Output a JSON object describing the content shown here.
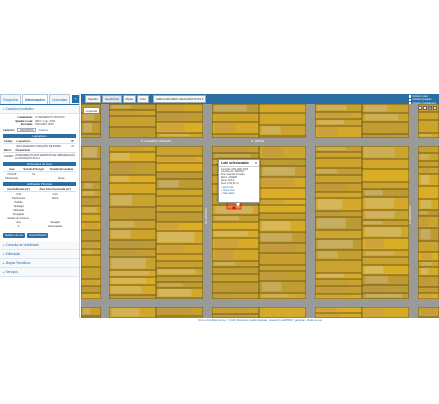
{
  "left_panel": {
    "tabs": [
      {
        "label": "Geoportal"
      },
      {
        "label": "Informações"
      },
      {
        "label": "Consultas"
      }
    ],
    "sections": {
      "cadastro_header": "Cadastro Imobiliário",
      "consulta_header": "Consulta de Viabilidade",
      "edificacao_header": "Edificação",
      "mapas_header": "Mapas Temáticos",
      "servicos_header": "Serviços"
    },
    "cadastro": {
      "loteamento_label": "Loteamento:",
      "loteamento_value": "LOTEAMENTO CENTRO",
      "quadra_label": "Quadra / Lote:",
      "quadra_value": "0827 / Lote: 0033",
      "inscricao_label": "Inscrição:",
      "inscricao_value": "0001.0827.0033",
      "cadastro_label": "Cadastro:",
      "cadastro_value": "0012345678",
      "cadastro_link": "Cadastro"
    },
    "logradouro": {
      "bar": "Logradouro",
      "headers": [
        "Código",
        "Logradouro",
        "Nº"
      ],
      "rows": [
        [
          "",
          "RUA SAGRADO CORAÇÃO DE MARIA",
          "27"
        ]
      ]
    },
    "zoneamento": {
      "headers": [
        "Bairro",
        "Zoneamento"
      ],
      "rows": [
        [
          "JARDIM",
          "ZONEAMENTO DOS CENTROS DE URBANIZAÇÃO E OCUPAÇÃO ZCA-II"
        ]
      ]
    },
    "dimensoes": {
      "bar": "Dimensões da Área",
      "headers": [
        "Área",
        "Testada Principal",
        "Testada Secundária"
      ],
      "rows": [
        [
          "1732,00",
          "31",
          ""
        ]
      ],
      "pavimentos_label": "Pavimentos",
      "areas_label": "Áreas"
    },
    "edificacao": {
      "bar": "Edificação Principal",
      "headers": [
        "Área Edificada (m²)",
        "Área Total Construída (m²)"
      ],
      "rows": [
        [
          "0,00",
          "0,00"
        ]
      ],
      "fields": [
        [
          "Pavimentos",
          "Altura"
        ],
        [
          "Padrão",
          ""
        ],
        [
          "Tipologia",
          ""
        ],
        [
          "Utilização",
          ""
        ],
        [
          "Ocupação",
          ""
        ],
        [
          "Estado de Conserv.",
          ""
        ]
      ],
      "ano_headers": [
        "Ano",
        "Situação"
      ],
      "ano_row": [
        "0",
        "Desocupado"
      ]
    },
    "buttons": {
      "detalhes": "Detalhes do Lote",
      "imprimir": "Imprimir Boletim"
    }
  },
  "map": {
    "toolbar": {
      "btn_satelite": "Satélite",
      "btn_geoportal": "GeoPortal",
      "btn_mapa": "Mapa",
      "btn_foto": "Foto",
      "dropdown": "SIMULADORES GEOGRÁFICOS"
    },
    "layer_toggles": [
      "Ocultar Lotes",
      "Ocultar Quadras",
      "Ocultar Logradouros",
      "Mostrar Bairros"
    ],
    "legend_btn": "Legenda",
    "zoom_tools": [
      "+",
      "-",
      "■",
      "□"
    ],
    "popup": {
      "title": "Lote selecionado",
      "lines": [
        "Inscrição: 0001.0827.0033",
        "Loteamento: CENTRO",
        "Rua: Sagrado Coração",
        "Bairro: JARDIM",
        "Zona: ZCA-II",
        "Área: 1732,00 m²"
      ],
      "links": [
        "+ Zoom lote",
        "+ Street View",
        "+ Mais dados"
      ]
    },
    "street_labels": [
      "R. SAGRADO CORAÇÃO",
      "R. JARDIM",
      "AV. CENTRAL",
      "R. SANTA RITA"
    ],
    "footer": "Termo e Condições de Uso · © 2020 | Sistema de Gestão Integrada · powered by GEOPROC | geoportal · Direitos de uso"
  },
  "colors": {
    "brand": "#2a6ea6",
    "parcel_fill": "#e6b422",
    "parcel_stroke": "#5a4a10",
    "street": "#9a9a96",
    "footer_link": "#2a6ea6"
  }
}
